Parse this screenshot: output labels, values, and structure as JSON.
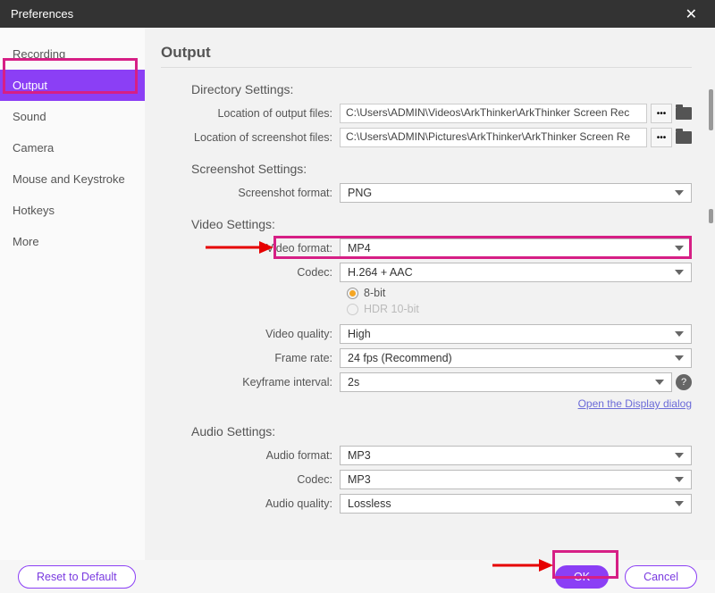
{
  "window": {
    "title": "Preferences"
  },
  "sidebar": {
    "items": [
      {
        "label": "Recording"
      },
      {
        "label": "Output",
        "active": true
      },
      {
        "label": "Sound"
      },
      {
        "label": "Camera"
      },
      {
        "label": "Mouse and Keystroke"
      },
      {
        "label": "Hotkeys"
      },
      {
        "label": "More"
      }
    ]
  },
  "page": {
    "title": "Output"
  },
  "directory": {
    "section": "Directory Settings:",
    "output_label": "Location of output files:",
    "output_path": "C:\\Users\\ADMIN\\Videos\\ArkThinker\\ArkThinker Screen Rec",
    "screenshot_label": "Location of screenshot files:",
    "screenshot_path": "C:\\Users\\ADMIN\\Pictures\\ArkThinker\\ArkThinker Screen Re"
  },
  "screenshot": {
    "section": "Screenshot Settings:",
    "format_label": "Screenshot format:",
    "format_value": "PNG"
  },
  "video": {
    "section": "Video Settings:",
    "format_label": "Video format:",
    "format_value": "MP4",
    "codec_label": "Codec:",
    "codec_value": "H.264 + AAC",
    "bit8": "8-bit",
    "hdr": "HDR 10-bit",
    "quality_label": "Video quality:",
    "quality_value": "High",
    "fps_label": "Frame rate:",
    "fps_value": "24 fps (Recommend)",
    "keyframe_label": "Keyframe interval:",
    "keyframe_value": "2s",
    "link": "Open the Display dialog"
  },
  "audio": {
    "section": "Audio Settings:",
    "format_label": "Audio format:",
    "format_value": "MP3",
    "codec_label": "Codec:",
    "codec_value": "MP3",
    "quality_label": "Audio quality:",
    "quality_value": "Lossless"
  },
  "footer": {
    "reset": "Reset to Default",
    "ok": "OK",
    "cancel": "Cancel"
  }
}
